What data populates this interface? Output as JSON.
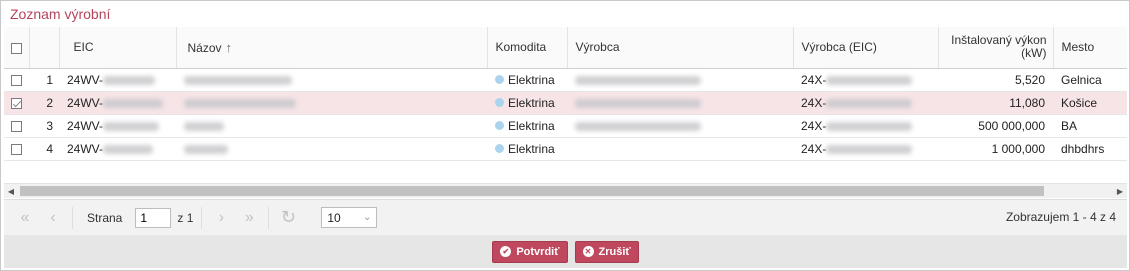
{
  "title": "Zoznam výrobní",
  "columns": {
    "eic": "EIC",
    "nazov": "Názov",
    "sort_arrow": "↑",
    "komodita": "Komodita",
    "vyrobca": "Výrobca",
    "vyrobca_eic": "Výrobca (EIC)",
    "vykon_line1": "Inštalovaný výkon",
    "vykon_line2": "(kW)",
    "mesto": "Mesto"
  },
  "rows": [
    {
      "idx": "1",
      "checked": false,
      "selected": false,
      "eic": "24WV-",
      "komodita": "Elektrina",
      "vyrobca_eic": "24X-",
      "vykon": "5,520",
      "mesto": "Gelnica"
    },
    {
      "idx": "2",
      "checked": true,
      "selected": true,
      "eic": "24WV-",
      "komodita": "Elektrina",
      "vyrobca_eic": "24X-",
      "vykon": "11,080",
      "mesto": "Košice"
    },
    {
      "idx": "3",
      "checked": false,
      "selected": false,
      "eic": "24WV-",
      "komodita": "Elektrina",
      "vyrobca_eic": "24X-",
      "vykon": "500 000,000",
      "mesto": "BA"
    },
    {
      "idx": "4",
      "checked": false,
      "selected": false,
      "eic": "24WV-",
      "komodita": "Elektrina",
      "vyrobca_eic": "24X-",
      "vykon": "1 000,000",
      "mesto": "dhbdhrs"
    }
  ],
  "pager": {
    "first_icon": "«",
    "prev_icon": "‹",
    "page_label": "Strana",
    "page_value": "1",
    "of_label": "z 1",
    "next_icon": "›",
    "last_icon": "»",
    "refresh_icon": "↻",
    "page_size": "10",
    "info": "Zobrazujem 1 - 4 z 4"
  },
  "buttons": {
    "confirm": "Potvrdiť",
    "cancel": "Zrušiť"
  },
  "colors": {
    "accent": "#c0485e",
    "selected_row": "#f6e4e7",
    "komodita_dot": "#a9d4ec"
  }
}
